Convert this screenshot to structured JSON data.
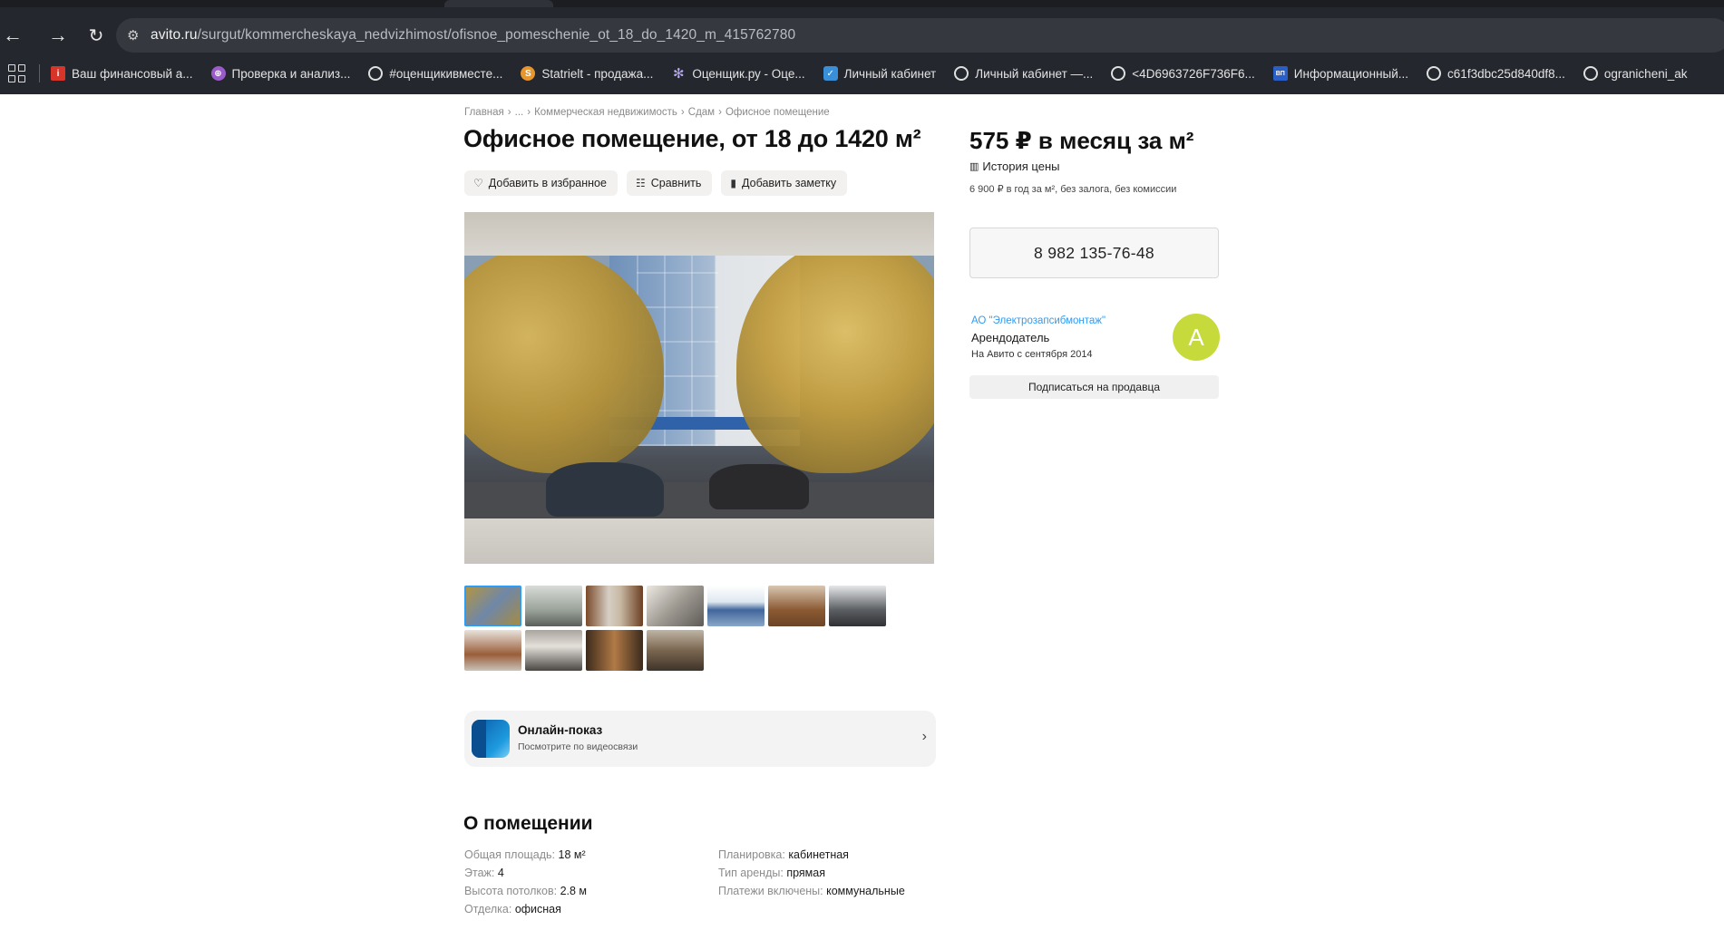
{
  "browser": {
    "url_host": "avito.ru",
    "url_path": "/surgut/kommercheskaya_nedvizhimost/ofisnoe_pomeschenie_ot_18_do_1420_m_415762780",
    "bookmarks": [
      {
        "label": "Ваш финансовый а...",
        "icon": "finance-bookmark-icon",
        "style": "ic-red",
        "glyph": "і"
      },
      {
        "label": "Проверка и анализ...",
        "icon": "check-bookmark-icon",
        "style": "ic-purple",
        "glyph": "⊕"
      },
      {
        "label": "#оценщикивместе...",
        "icon": "globe-icon",
        "style": "ic-globe",
        "glyph": ""
      },
      {
        "label": "Statrielt - продажа...",
        "icon": "statrielt-bookmark-icon",
        "style": "ic-orange",
        "glyph": "S"
      },
      {
        "label": "Оценщик.ру - Оце...",
        "icon": "snowflake-bookmark-icon",
        "style": "ic-snow",
        "glyph": "✻"
      },
      {
        "label": "Личный кабинет",
        "icon": "checkmark-bookmark-icon",
        "style": "ic-check",
        "glyph": "✓"
      },
      {
        "label": "Личный кабинет —...",
        "icon": "globe-icon",
        "style": "ic-globe",
        "glyph": ""
      },
      {
        "label": "<4D6963726F736F6...",
        "icon": "globe-icon",
        "style": "ic-globe",
        "glyph": ""
      },
      {
        "label": "Информационный...",
        "icon": "info-bookmark-icon",
        "style": "ic-blue",
        "glyph": "ВП"
      },
      {
        "label": "c61f3dbc25d840df8...",
        "icon": "globe-icon",
        "style": "ic-globe",
        "glyph": ""
      },
      {
        "label": "ogranicheni_ak",
        "icon": "globe-icon",
        "style": "ic-globe",
        "glyph": ""
      }
    ]
  },
  "breadcrumb": [
    "Главная",
    "...",
    "Коммерческая недвижимость",
    "Сдам",
    "Офисное помещение"
  ],
  "listing": {
    "title": "Офисное помещение, от 18 до 1420 м²",
    "actions": {
      "favorite": "Добавить в избранное",
      "compare": "Сравнить",
      "note": "Добавить заметку"
    },
    "photo_count": 11,
    "online_show": {
      "title": "Онлайн-показ",
      "subtitle": "Посмотрите по видеосвязи"
    },
    "about": {
      "title": "О помещении",
      "left": [
        {
          "key": "Общая площадь:",
          "value": "18 м²"
        },
        {
          "key": "Этаж:",
          "value": "4"
        },
        {
          "key": "Высота потолков:",
          "value": "2.8 м"
        },
        {
          "key": "Отделка:",
          "value": "офисная"
        }
      ],
      "right": [
        {
          "key": "Планировка:",
          "value": "кабинетная"
        },
        {
          "key": "Тип аренды:",
          "value": "прямая"
        },
        {
          "key": "Платежи включены:",
          "value": "коммунальные"
        }
      ]
    }
  },
  "pricing": {
    "price": "575 ₽ в месяц за м²",
    "history_label": "История цены",
    "note": "6 900 ₽ в год за м², без залога, без комиссии",
    "phone": "8 982 135-76-48"
  },
  "seller": {
    "name": "АО \"Электрозапсибмонтаж\"",
    "role": "Арендодатель",
    "since": "На Авито с сентября 2014",
    "avatar_letter": "А",
    "avatar_color": "#c7da3c",
    "subscribe_label": "Подписаться на продавца"
  }
}
